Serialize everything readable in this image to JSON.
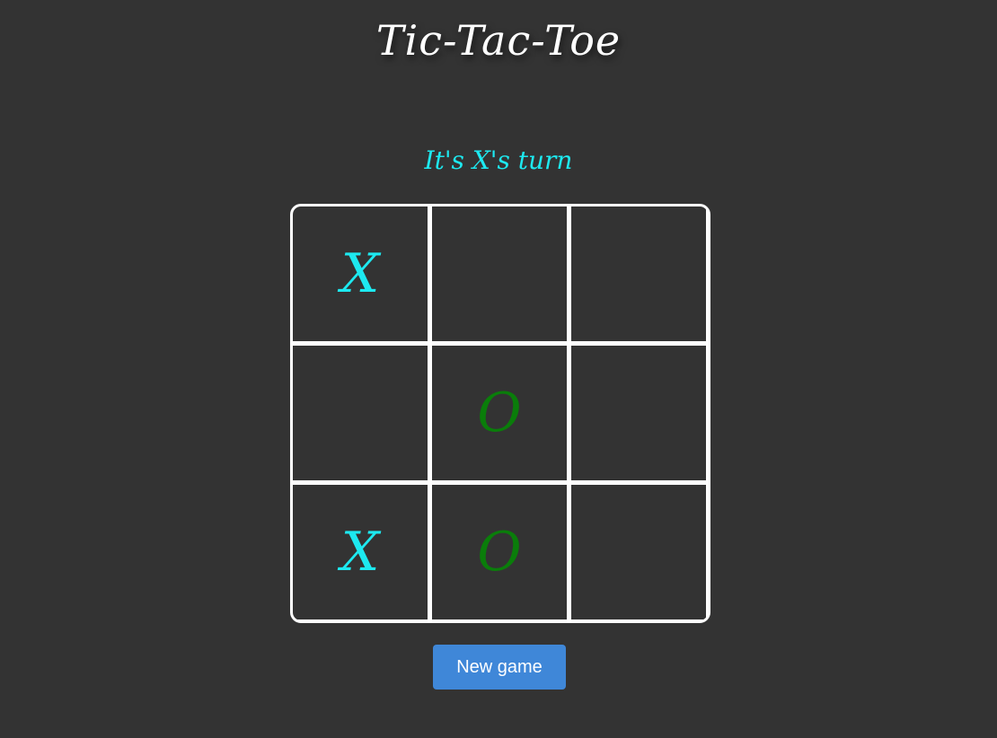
{
  "title": "Tic-Tac-Toe",
  "status": "It's X's turn",
  "colors": {
    "background": "#333333",
    "x_mark": "#1de9f0",
    "o_mark": "#0a7d0a",
    "board_lines": "#ffffff",
    "status_text": "#1de9f0",
    "button_bg": "#3f87d8",
    "button_text": "#ffffff"
  },
  "board": [
    [
      "X",
      "",
      ""
    ],
    [
      "",
      "O",
      ""
    ],
    [
      "X",
      "O",
      ""
    ]
  ],
  "new_game_label": "New game"
}
